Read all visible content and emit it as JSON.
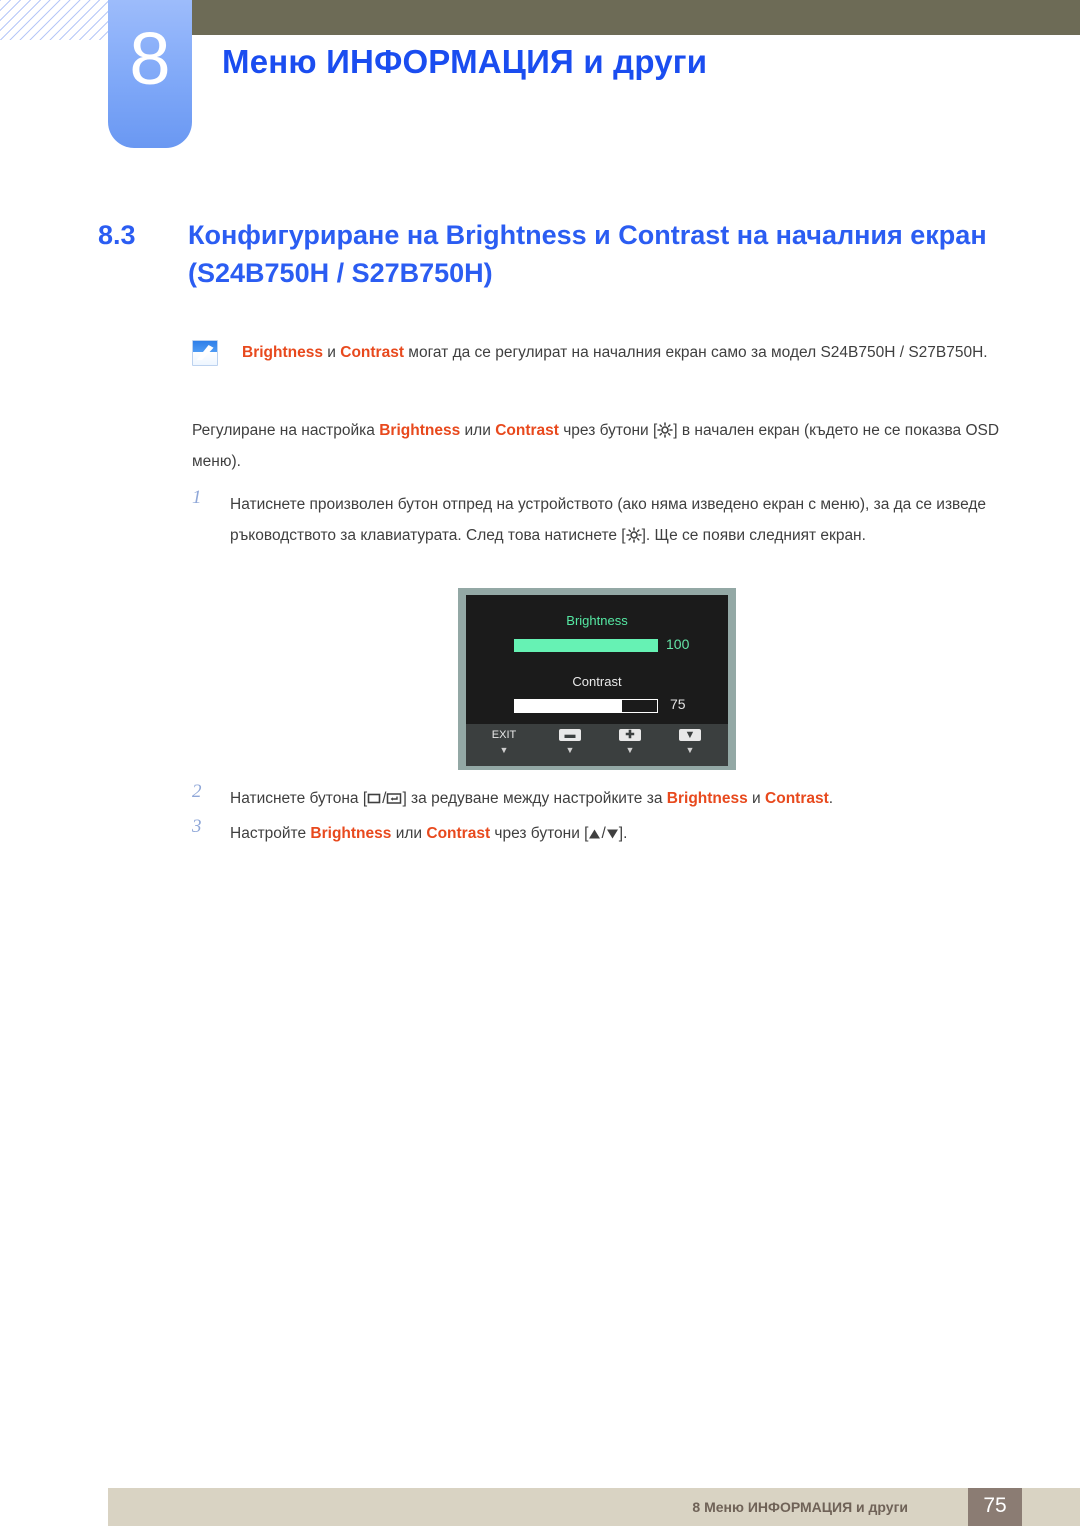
{
  "chapter": {
    "number": "8",
    "title": "Меню ИНФОРМАЦИЯ и други"
  },
  "section": {
    "number": "8.3",
    "title": "Конфигуриране на Brightness и Contrast на началния екран (S24B750H / S27B750H)"
  },
  "note": {
    "icon": "note-pencil-icon",
    "text_before": "",
    "kw1": "Brightness",
    "mid1": " и ",
    "kw2": "Contrast",
    "text_after": " могат да се регулират на началния екран само за модел S24B750H / S27B750H."
  },
  "intro": {
    "part1": "Регулиране на настройка ",
    "kw1": "Brightness",
    "part2": " или ",
    "kw2": "Contrast",
    "part3": " чрез бутони [",
    "icon": "brightness-sun-icon",
    "part4": "] в начален екран (където не се показва OSD меню)."
  },
  "steps": [
    {
      "number": "1",
      "part1": "Натиснете произволен бутон отпред на устройството (ако няма изведено екран с меню), за да се изведе ръководството за клавиатурата. След това натиснете [",
      "icon": "brightness-sun-icon",
      "part2": "]. Ще се появи следният екран."
    },
    {
      "number": "2",
      "part1": "Натиснете бутона [",
      "icon1": "rectangle-outline-icon",
      "sep": "/",
      "icon2": "enter-return-icon",
      "part2": "] за редуване между настройките за ",
      "kw1": "Brightness",
      "part3": " и ",
      "kw2": "Contrast",
      "part4": "."
    },
    {
      "number": "3",
      "part1": "Настройте ",
      "kw1": "Brightness",
      "part2": " или ",
      "kw2": "Contrast",
      "part3": " чрез бутони [",
      "icon1": "triangle-up-icon",
      "sep": "/",
      "icon2": "triangle-down-icon",
      "part4": "]."
    }
  ],
  "osd": {
    "brightness_label": "Brightness",
    "brightness_value": "100",
    "brightness_percent": 100,
    "contrast_label": "Contrast",
    "contrast_value": "75",
    "contrast_percent": 75,
    "buttons": [
      {
        "label": "EXIT",
        "glyph": "",
        "caret": "▼",
        "icon": "exit-button"
      },
      {
        "label": "",
        "glyph": "▬",
        "caret": "▼",
        "icon": "minus-button"
      },
      {
        "label": "",
        "glyph": "✚",
        "caret": "▼",
        "icon": "plus-button"
      },
      {
        "label": "",
        "glyph": "▼",
        "caret": "▼",
        "icon": "down-button"
      }
    ]
  },
  "footer": {
    "text": "8 Меню ИНФОРМАЦИЯ и други",
    "page": "75"
  },
  "colors": {
    "heading_blue": "#2b5df2",
    "keyword_orange": "#e8491d",
    "olive": "#6d6b56",
    "tab_blue": "#7fa8f8",
    "footer_beige": "#d9d3c3",
    "footer_page_box": "#8b7c73",
    "osd_border": "#93a8a5",
    "osd_screen": "#1b1b1b",
    "osd_green": "#66f2b4"
  }
}
